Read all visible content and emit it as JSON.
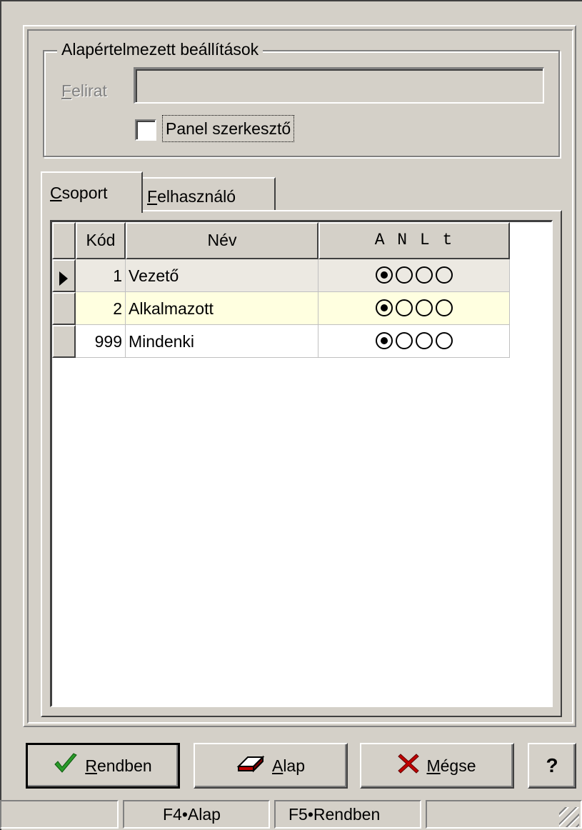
{
  "group": {
    "title": "Alapértelmezett beállítások",
    "felirat_label": "Felirat",
    "felirat_value": "",
    "panel_checkbox_label": "Panel szerkesztő",
    "panel_checkbox_checked": false
  },
  "tabs": [
    {
      "label": "Csoport",
      "active": true
    },
    {
      "label": "Felhasználó",
      "active": false
    }
  ],
  "grid": {
    "columns": [
      "Kód",
      "Név",
      "A N L t"
    ],
    "rows": [
      {
        "kod": "1",
        "nev": "Vezető",
        "selected_option": 1,
        "current": true
      },
      {
        "kod": "2",
        "nev": "Alkalmazott",
        "selected_option": 1,
        "highlight": true
      },
      {
        "kod": "999",
        "nev": "Mindenki",
        "selected_option": 1
      }
    ],
    "highlight_color": "#ffffe0",
    "current_row_color": "#ece9e2"
  },
  "buttons": {
    "ok": "Rendben",
    "alap": "Alap",
    "cancel": "Mégse",
    "help": "?"
  },
  "statusbar": [
    "",
    "F4•Alap",
    "F5•Rendben",
    ""
  ],
  "icons": {
    "ok": "checkmark-icon",
    "alap": "eraser-icon",
    "cancel": "x-icon"
  },
  "colors": {
    "ok_check": "#2a9a2a",
    "cancel_x": "#c00000",
    "alap_icon": "#c00000"
  }
}
